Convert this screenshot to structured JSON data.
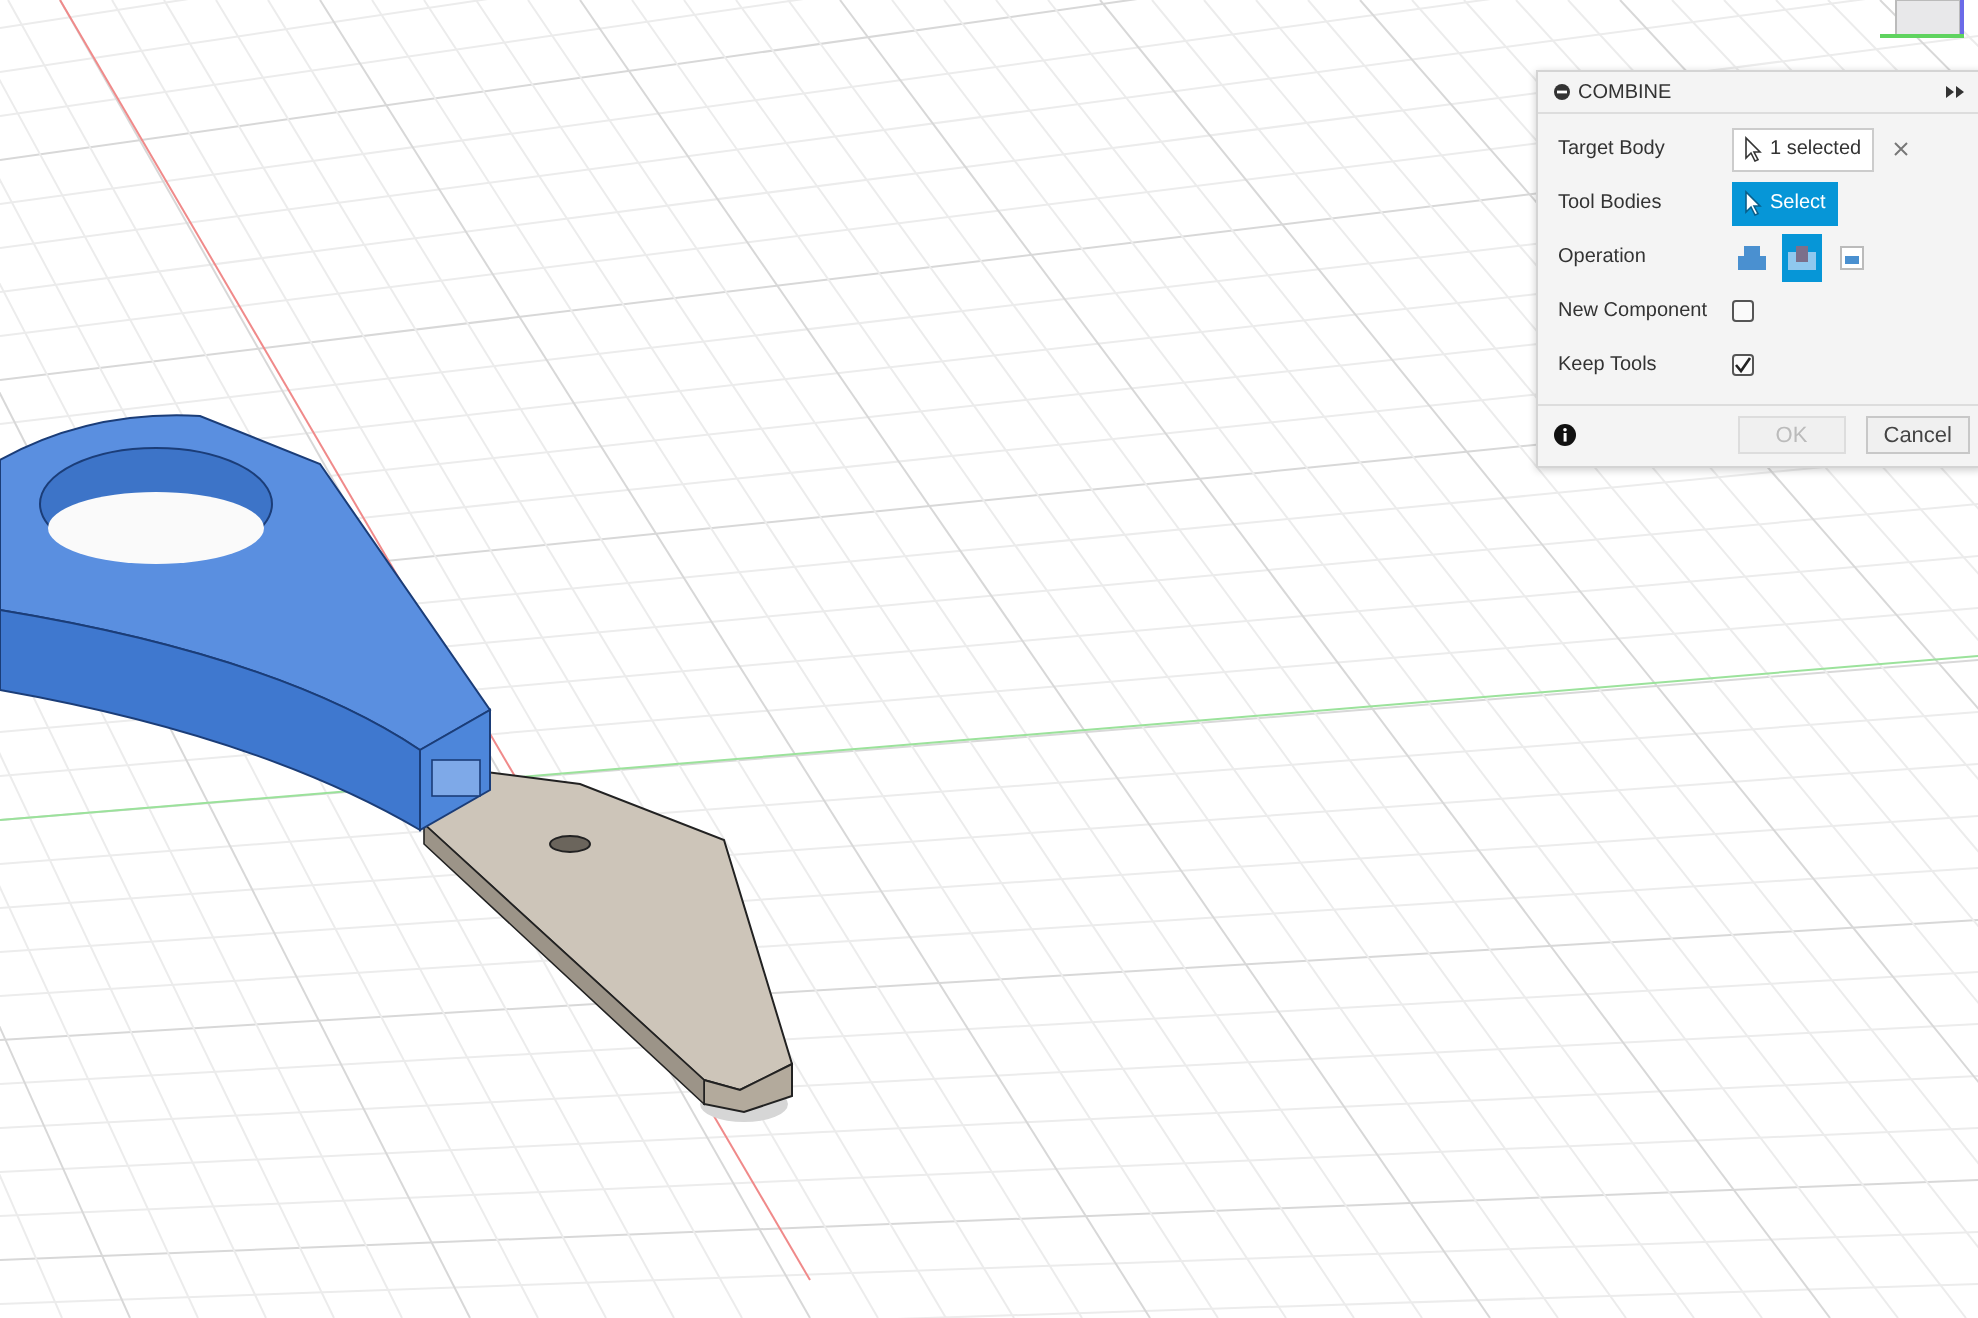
{
  "dialog": {
    "title": "COMBINE",
    "rows": [
      {
        "kind": "selection",
        "label": "Target Body",
        "value": "1 selected",
        "active": false
      },
      {
        "kind": "selection",
        "label": "Tool Bodies",
        "value": "Select",
        "active": true
      },
      {
        "kind": "operation",
        "label": "Operation",
        "options": [
          {
            "kind": "join",
            "selected": false
          },
          {
            "kind": "cut",
            "selected": true
          },
          {
            "kind": "intersect",
            "selected": false
          }
        ]
      },
      {
        "kind": "checkbox",
        "label": "New Component",
        "checked": false
      },
      {
        "kind": "checkbox",
        "label": "Keep Tools",
        "checked": true
      }
    ],
    "buttons": [
      {
        "label": "OK",
        "disabled": true
      },
      {
        "label": "Cancel",
        "disabled": false
      }
    ]
  }
}
